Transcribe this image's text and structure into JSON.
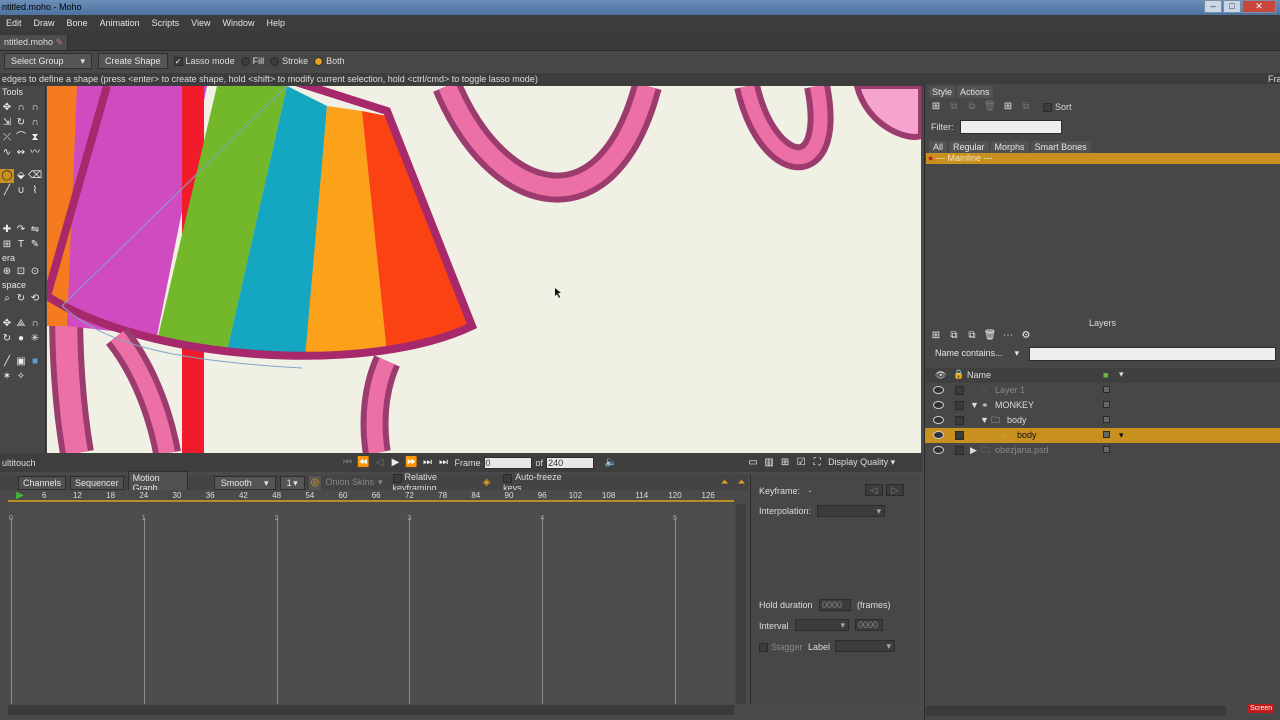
{
  "window": {
    "title": "ntitled.moho - Moho"
  },
  "menu": [
    "Edit",
    "Draw",
    "Bone",
    "Animation",
    "Scripts",
    "View",
    "Window",
    "Help"
  ],
  "doc_tab": {
    "label": "ntitled.moho"
  },
  "tool_options": {
    "select_group": "Select Group",
    "create_shape": "Create Shape",
    "lasso_mode": "Lasso mode",
    "fill": "Fill",
    "stroke": "Stroke",
    "both": "Both",
    "lasso_checked": true,
    "selected_radio": "Both"
  },
  "hint_text": "edges to define a shape (press <enter> to create shape, hold <shift> to modify current selection, hold <ctrl/cmd> to toggle lasso mode)",
  "hint_right": "Fra",
  "tools_panel": {
    "title": "Tools",
    "sections": [
      "era",
      "space"
    ]
  },
  "bottom_bar": {
    "left_label": "ultitouch",
    "frame_label": "Frame",
    "frame_value": "0",
    "of_label": "of",
    "total_frames": "240",
    "display_quality": "Display Quality"
  },
  "timeline": {
    "tabs": [
      "Channels",
      "Sequencer",
      "Motion Graph"
    ],
    "interp_select": "Smooth",
    "step_value": "1",
    "onion_skins": "Onion Skins",
    "relative_keyframing": "Relative keyframing",
    "auto_freeze": "Auto-freeze keys",
    "ruler_ticks": [
      "0",
      "6",
      "12",
      "18",
      "24",
      "30",
      "36",
      "42",
      "48",
      "54",
      "60",
      "66",
      "72",
      "78",
      "84",
      "90",
      "96",
      "102",
      "108",
      "114",
      "120",
      "126"
    ],
    "second_marks": [
      "0",
      "1",
      "2",
      "3",
      "4",
      "5"
    ]
  },
  "keyframe_panel": {
    "keyframe_label": "Keyframe:",
    "keyframe_value": "-",
    "interpolation_label": "Interpolation:",
    "hold_duration_label": "Hold duration",
    "hold_duration_value": "0000",
    "frames_label": "(frames)",
    "interval_label": "Interval",
    "interval_value": "0000",
    "stagger_label": "Stagger",
    "label_label": "Label"
  },
  "style_actions": {
    "tabs": [
      "Style",
      "Actions"
    ],
    "sort_label": "Sort",
    "filter_label": "Filter:",
    "subtabs": [
      "All",
      "Regular",
      "Morphs",
      "Smart Bones"
    ],
    "mainline": "--- Mainline ---"
  },
  "layers_panel": {
    "title": "Layers",
    "name_filter": "Name contains...",
    "name_col": "Name",
    "layers": [
      {
        "name": "Layer 1",
        "indent": 0,
        "dim": true,
        "selected": false
      },
      {
        "name": "MONKEY",
        "indent": 0,
        "dim": false,
        "selected": false
      },
      {
        "name": "body",
        "indent": 1,
        "dim": false,
        "selected": false
      },
      {
        "name": "body",
        "indent": 2,
        "dim": false,
        "selected": true
      },
      {
        "name": "obezjana.psd",
        "indent": 0,
        "dim": true,
        "selected": false
      }
    ]
  },
  "colors": {
    "accent": "#c8901e",
    "panel": "#474747"
  },
  "taskbar_logo": "Screen"
}
